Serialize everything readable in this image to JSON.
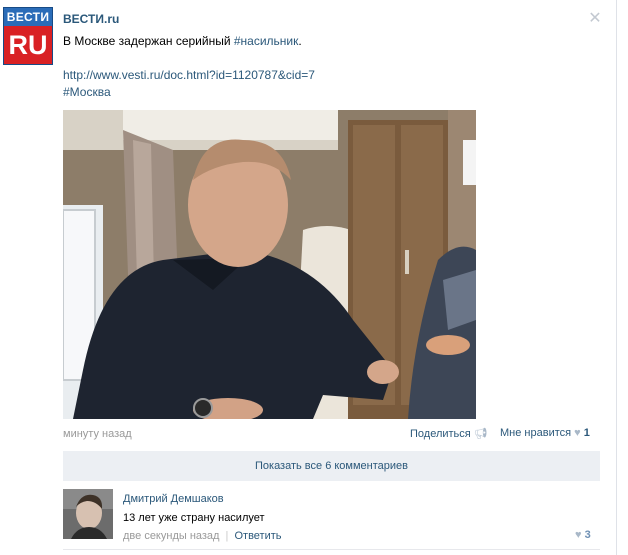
{
  "post": {
    "author": "ВЕСТИ.ru",
    "logo_top": "ВЕСТИ",
    "logo_bottom": "RU",
    "text_prefix": "В Москве задержан серийный ",
    "text_tag": "#насильник",
    "text_suffix": ".",
    "link": "http://www.vesti.ru/doc.html?id=1120787&cid=7",
    "hashtag": "#Москва",
    "time": "минуту назад",
    "share_label": "Поделиться",
    "like_label": "Мне нравится",
    "like_count": "1"
  },
  "comments_bar": {
    "label": "Показать все 6 комментариев"
  },
  "comment": {
    "author": "Дмитрий Демшаков",
    "text": "13 лет уже страну насилует",
    "time": "две секунды назад",
    "separator": "|",
    "reply_label": "Ответить",
    "like_count": "3"
  },
  "icons": {
    "close": "close-icon",
    "share": "megaphone-icon",
    "like": "heart-icon"
  },
  "colors": {
    "link": "#2b587a",
    "muted": "#999999",
    "comments_bar_bg": "#eceff3",
    "logo_blue": "#2a6cb8",
    "logo_red": "#d92124"
  }
}
